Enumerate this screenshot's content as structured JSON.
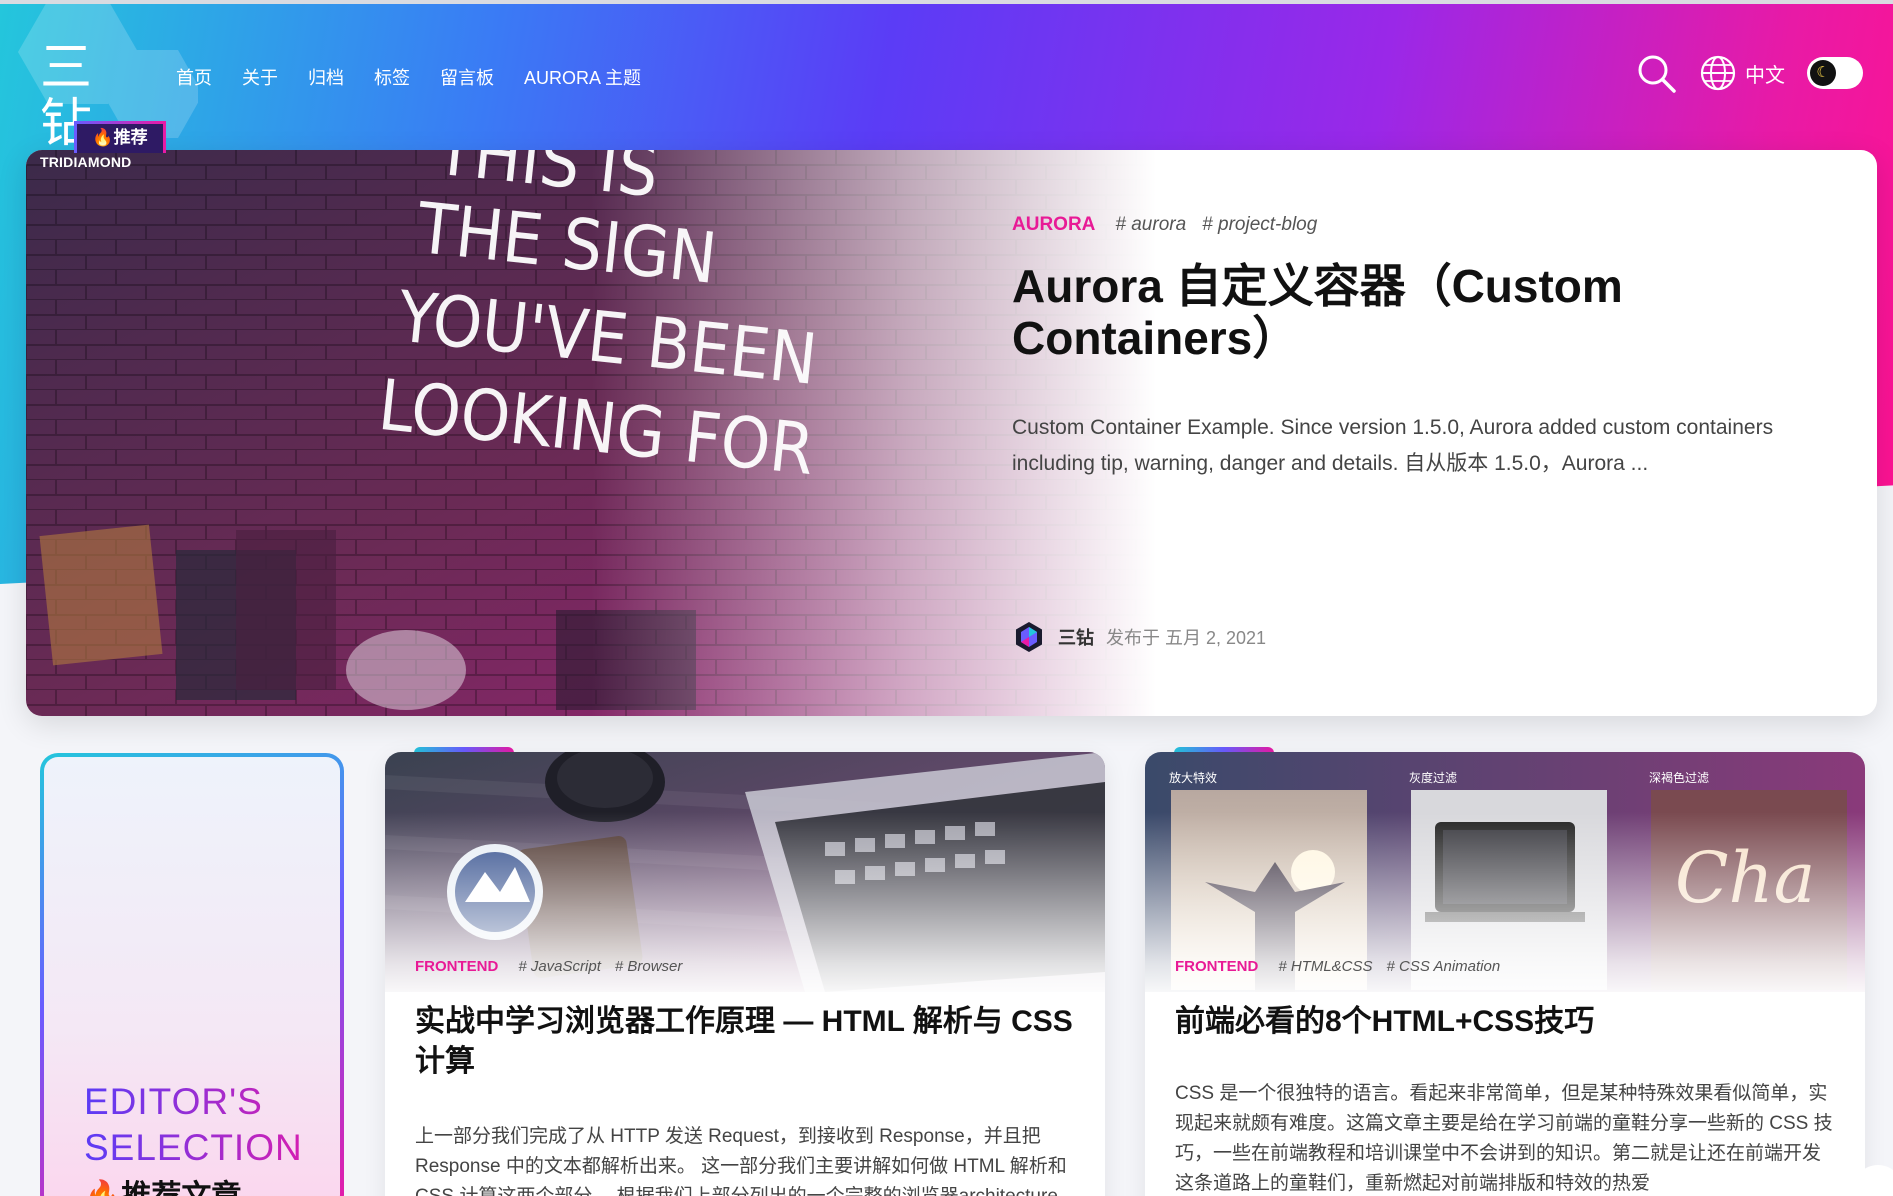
{
  "header": {
    "logo_mark": "三钻",
    "logo_sub": "TRIDIAMOND",
    "nav": [
      "首页",
      "关于",
      "归档",
      "标签",
      "留言板",
      "AURORA 主题"
    ],
    "language": "中文",
    "dark_mode_icon": "moon-icon"
  },
  "colors": {
    "accent_pink": "#e81a96",
    "gradient_start": "#24c6dc",
    "gradient_mid": "#5b3cf6",
    "gradient_end": "#ff1291"
  },
  "featured": {
    "badge": "推荐",
    "category": "AURORA",
    "tags": [
      "# aurora",
      "# project-blog"
    ],
    "title": "Aurora 自定义容器（Custom Containers）",
    "excerpt": "Custom Container Example. Since version 1.5.0, Aurora added custom containers including tip, warning, danger and details. 自从版本 1.5.0，Aurora ...",
    "author": "三钻",
    "published": "发布于 五月 2, 2021",
    "image_text": "THIS IS THE SIGN YOU'VE BEEN LOOKING FOR"
  },
  "editor": {
    "title": "EDITOR'S SELECTION",
    "subtitle": "推荐文章"
  },
  "cards": [
    {
      "category": "FRONTEND",
      "tags": [
        "# JavaScript",
        "# Browser"
      ],
      "title": "实战中学习浏览器工作原理 — HTML 解析与 CSS 计算",
      "excerpt": "上一部分我们完成了从 HTTP 发送 Request，到接收到 Response，并且把 Response 中的文本都解析出来。 这一部分我们主要讲解如何做 HTML 解析和 CSS 计算这两个部分。 根据我们上部分列出的一个完整的浏览器architecture"
    },
    {
      "category": "FRONTEND",
      "tags": [
        "# HTML&CSS",
        "# CSS Animation"
      ],
      "title": "前端必看的8个HTML+CSS技巧",
      "excerpt": "CSS 是一个很独特的语言。看起来非常简单，但是某种特殊效果看似简单，实现起来就颇有难度。这篇文章主要是给在学习前端的童鞋分享一些新的 CSS 技巧，一些在前端教程和培训课堂中不会讲到的知识。第二就是让还在前端开发这条道路上的童鞋们，重新燃起对前端排版和特效的热爱",
      "image_labels": [
        "放大特效",
        "灰度过滤",
        "深褐色过滤"
      ]
    }
  ]
}
